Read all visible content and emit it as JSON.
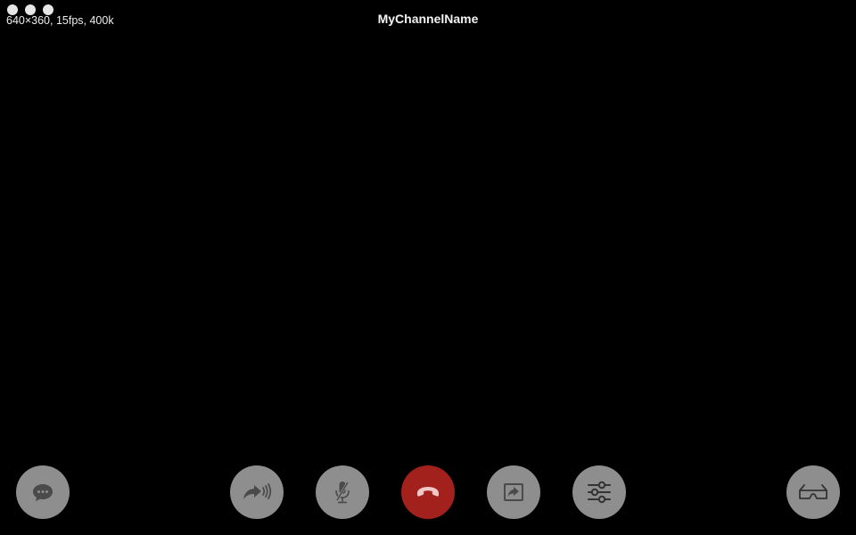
{
  "window": {
    "title": "MyChannelName",
    "stats": "640×360, 15fps, 400k"
  },
  "colors": {
    "background": "#000000",
    "button": "#8e8e8e",
    "icon": "#4a4a4a",
    "hangup": "#a3211c",
    "text": "#f2f2f2"
  },
  "controls": [
    {
      "name": "chat-button",
      "icon": "chat-bubble-icon"
    },
    {
      "name": "broadcast-button",
      "icon": "share-broadcast-icon"
    },
    {
      "name": "mute-button",
      "icon": "microphone-off-icon"
    },
    {
      "name": "hangup-button",
      "icon": "phone-hangup-icon"
    },
    {
      "name": "screen-share-button",
      "icon": "screen-share-icon"
    },
    {
      "name": "settings-button",
      "icon": "sliders-icon"
    },
    {
      "name": "stereo-3d-button",
      "icon": "3d-glasses-icon"
    }
  ]
}
